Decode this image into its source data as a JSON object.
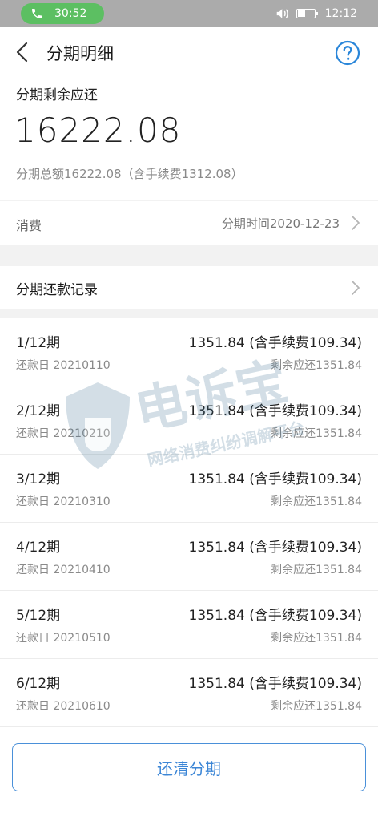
{
  "status": {
    "call_time": "30:52",
    "clock": "12:12",
    "battery_level": 0.45
  },
  "header": {
    "title": "分期明细",
    "back_icon": "back-arrow-icon",
    "help_icon": "question-circle-icon"
  },
  "summary": {
    "label": "分期剩余应还",
    "amount": "16222.08",
    "total": "分期总额16222.08（含手续费1312.08）"
  },
  "consume": {
    "label": "消费",
    "time": "分期时间2020-12-23"
  },
  "records": {
    "title": "分期还款记录"
  },
  "installments": [
    {
      "period": "1/12期",
      "amount": "1351.84 (含手续费109.34)",
      "due": "还款日 20210110",
      "remain": "剩余应还1351.84"
    },
    {
      "period": "2/12期",
      "amount": "1351.84 (含手续费109.34)",
      "due": "还款日 20210210",
      "remain": "剩余应还1351.84"
    },
    {
      "period": "3/12期",
      "amount": "1351.84 (含手续费109.34)",
      "due": "还款日 20210310",
      "remain": "剩余应还1351.84"
    },
    {
      "period": "4/12期",
      "amount": "1351.84 (含手续费109.34)",
      "due": "还款日 20210410",
      "remain": "剩余应还1351.84"
    },
    {
      "period": "5/12期",
      "amount": "1351.84 (含手续费109.34)",
      "due": "还款日 20210510",
      "remain": "剩余应还1351.84"
    },
    {
      "period": "6/12期",
      "amount": "1351.84 (含手续费109.34)",
      "due": "还款日 20210610",
      "remain": "剩余应还1351.84"
    }
  ],
  "watermark": {
    "brand": "电诉宝",
    "slogan": "网络消费纠纷调解平台"
  },
  "footer": {
    "payoff_label": "还清分期"
  },
  "colors": {
    "accent": "#3c86d6",
    "call_green": "#5cbf62",
    "status_gray": "#ababab"
  }
}
